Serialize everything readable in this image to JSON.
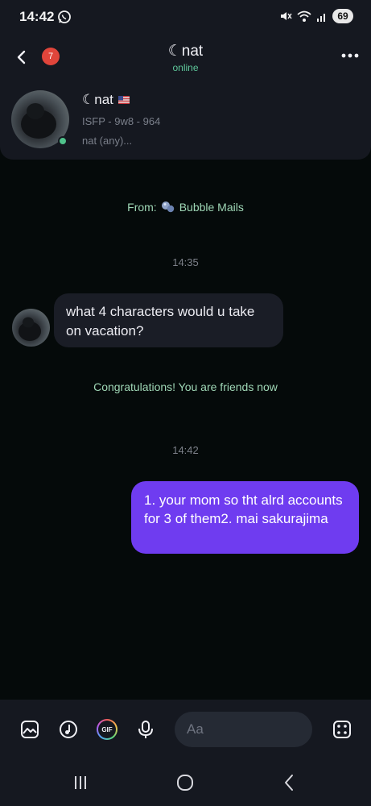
{
  "status_bar": {
    "time": "14:42",
    "battery": "69"
  },
  "header": {
    "badge_count": "7",
    "title": "☾nat",
    "status": "online"
  },
  "profile": {
    "name": "☾nat",
    "info": "ISFP - 9w8 - 964",
    "pronouns": "nat (any)..."
  },
  "chat": {
    "from_label": "From:",
    "from_source": "Bubble Mails",
    "timestamp_1": "14:35",
    "incoming_message": "what 4 characters would u take on vacation?",
    "system_note": "Congratulations! You are friends now",
    "timestamp_2": "14:42",
    "outgoing_message": "1. your mom so tht alrd accounts for 3 of them2. mai sakurajima"
  },
  "composer": {
    "gif_label": "GIF",
    "placeholder": "Aa"
  },
  "colors": {
    "accent_purple": "#6f3cf0",
    "online_green": "#4fc28b",
    "badge_red": "#e0453b",
    "system_text_green": "#9fd7b6"
  }
}
